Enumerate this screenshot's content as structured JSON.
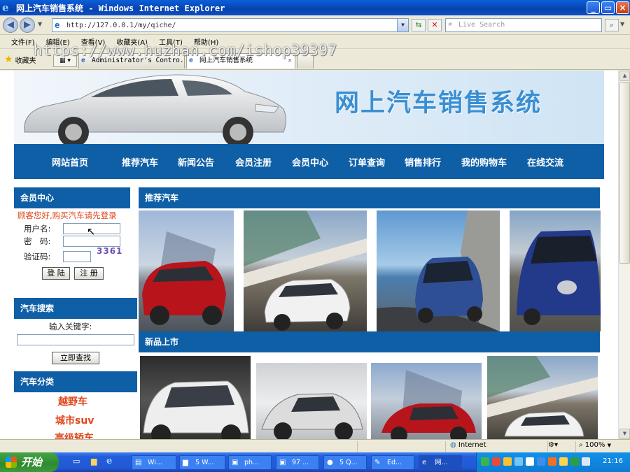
{
  "window": {
    "title": "网上汽车销售系统 - Windows Internet Explorer"
  },
  "addressbar": {
    "url": "http://127.0.0.1/my/qiche/",
    "search_placeholder": "Live Search"
  },
  "menu": [
    "文件(F)",
    "编辑(E)",
    "查看(V)",
    "收藏夹(A)",
    "工具(T)",
    "帮助(H)"
  ],
  "favorites_label": "收藏夹",
  "tabs": [
    {
      "label": "Administrator's Contro..."
    },
    {
      "label": "网上汽车销售系统"
    }
  ],
  "watermark": "https://www.huzhan.com/ishop39397",
  "site": {
    "title": "网上汽车销售系统",
    "nav": [
      "网站首页",
      "推荐汽车",
      "新闻公告",
      "会员注册",
      "会员中心",
      "订单查询",
      "销售排行",
      "我的购物车",
      "在线交流"
    ]
  },
  "member": {
    "header": "会员中心",
    "welcome": "顾客您好,购买汽车请先登录",
    "username_label": "用户名:",
    "password_label": "密　码:",
    "captcha_label": "验证码:",
    "captcha_value": "3361",
    "login_button": "登 陆",
    "register_button": "注 册"
  },
  "search": {
    "header": "汽车搜索",
    "keyword_label": "输入关键字:",
    "submit_button": "立即查找"
  },
  "categories": {
    "header": "汽车分类",
    "items": [
      "越野车",
      "城市suv",
      "高级轿车"
    ]
  },
  "sections": {
    "recommended": "推荐汽车",
    "new_arrivals": "新品上市"
  },
  "statusbar": {
    "zone": "Internet",
    "zoom": "100%"
  },
  "taskbar": {
    "start": "开始",
    "tasks": [
      "Wi...",
      "5 W...",
      "ph...",
      "97 ...",
      "5 Q...",
      "Ed...",
      "网..."
    ],
    "clock": "21:16"
  },
  "colors": {
    "nav_blue": "#0f5fa7",
    "accent_orange": "#e0451b",
    "title_blue": "#3a8fd3"
  }
}
